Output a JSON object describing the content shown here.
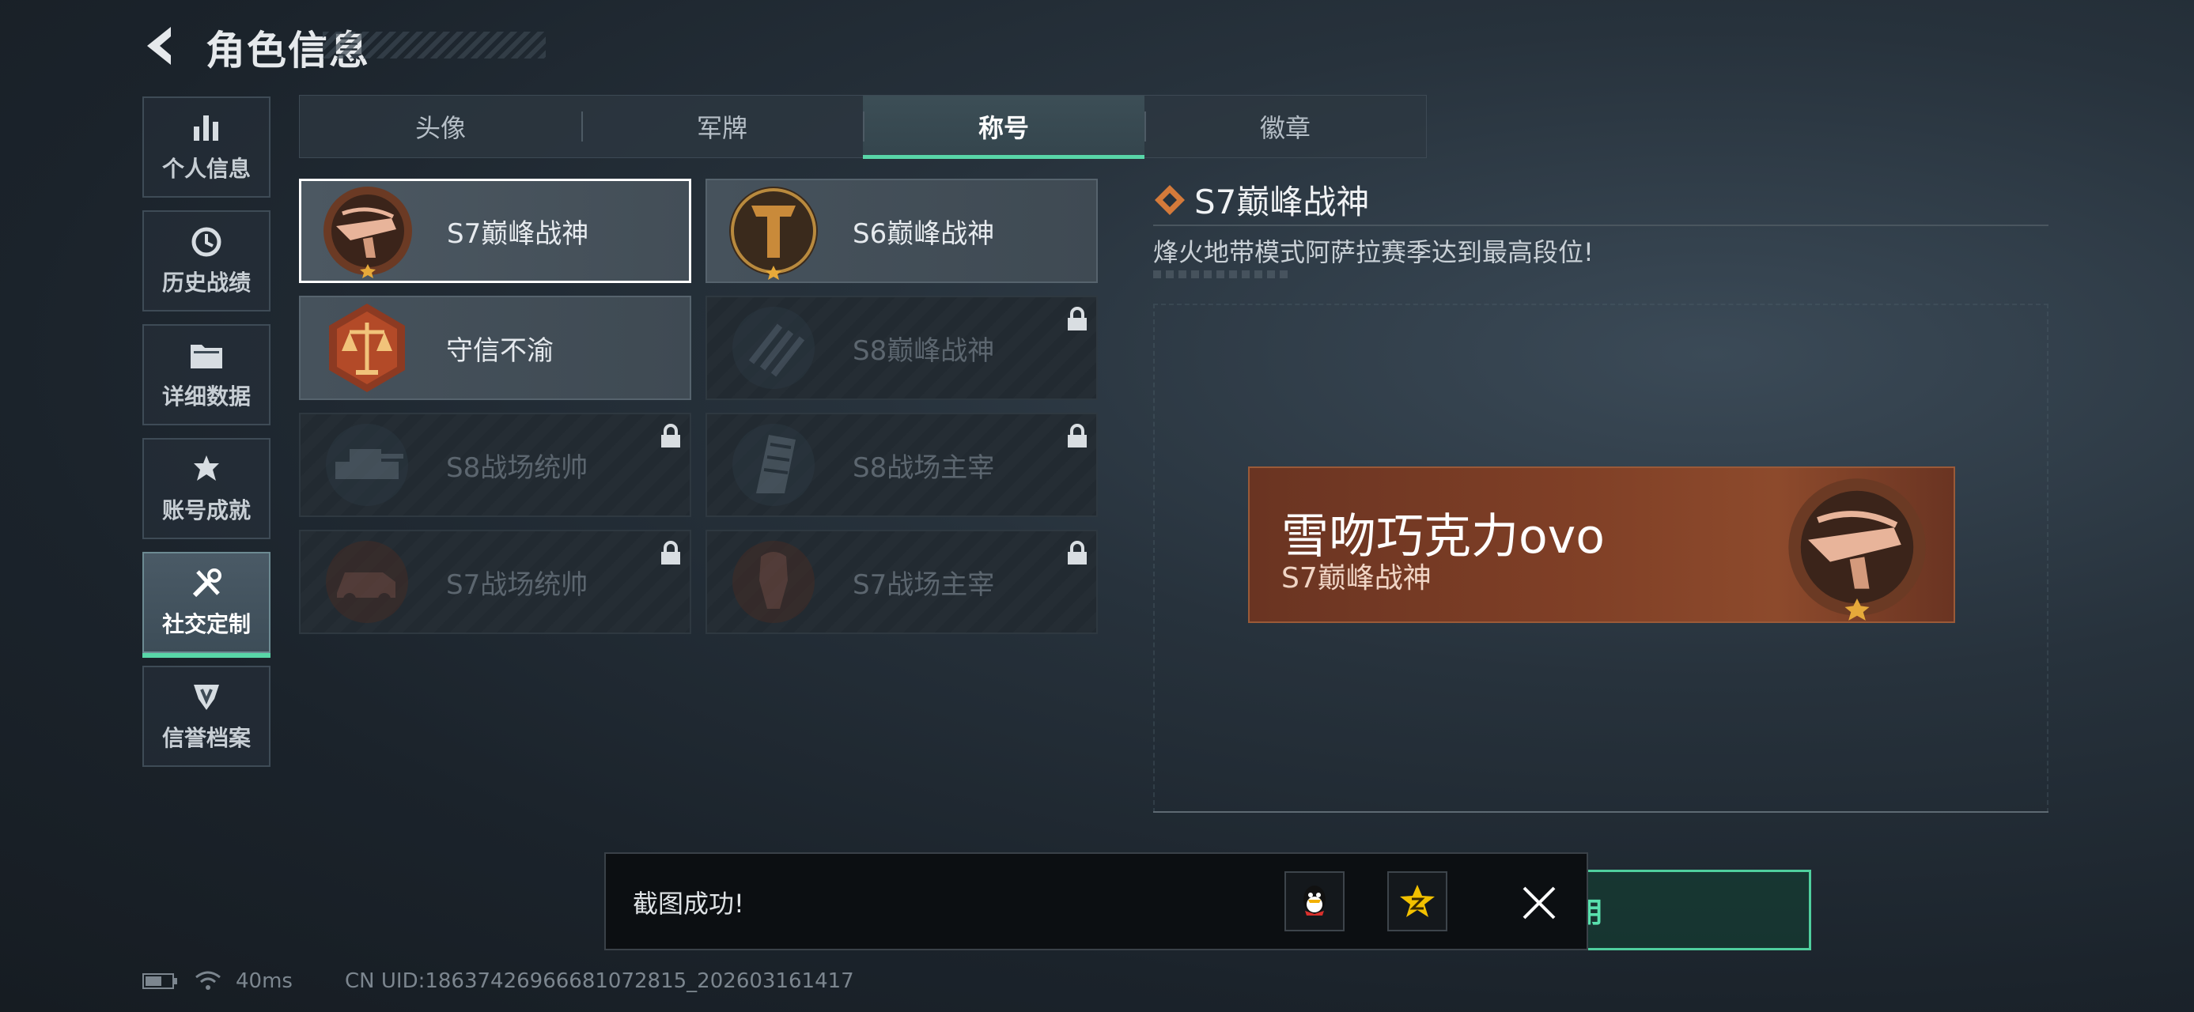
{
  "header": {
    "title": "角色信息"
  },
  "nav": {
    "items": [
      {
        "label": "个人信息",
        "icon": "bar-chart-icon"
      },
      {
        "label": "历史战绩",
        "icon": "clock-history-icon"
      },
      {
        "label": "详细数据",
        "icon": "folder-icon"
      },
      {
        "label": "账号成就",
        "icon": "achievement-icon"
      },
      {
        "label": "社交定制",
        "icon": "tools-icon",
        "active": true
      },
      {
        "label": "信誉档案",
        "icon": "shield-icon"
      }
    ]
  },
  "tabs": [
    {
      "label": "头像"
    },
    {
      "label": "军牌"
    },
    {
      "label": "称号",
      "active": true
    },
    {
      "label": "徽章"
    }
  ],
  "titles": [
    {
      "name": "S7巅峰战神",
      "locked": false,
      "selected": true,
      "emblem": "crossbow-emblem-icon"
    },
    {
      "name": "S6巅峰战神",
      "locked": false,
      "emblem": "t-shield-emblem-icon"
    },
    {
      "name": "守信不渝",
      "locked": false,
      "emblem": "scales-emblem-icon"
    },
    {
      "name": "S8巅峰战神",
      "locked": true,
      "emblem": "stripes-emblem-icon"
    },
    {
      "name": "S8战场统帅",
      "locked": true,
      "emblem": "tank-emblem-icon"
    },
    {
      "name": "S8战场主宰",
      "locked": true,
      "emblem": "tower-emblem-icon"
    },
    {
      "name": "S7战场统帅",
      "locked": true,
      "emblem": "vehicle-emblem-icon"
    },
    {
      "name": "S7战场主宰",
      "locked": true,
      "emblem": "soldier-emblem-icon"
    }
  ],
  "detail": {
    "title": "S7巅峰战神",
    "description": "烽火地带模式阿萨拉赛季达到最高段位!"
  },
  "preview": {
    "player_name": "雪吻巧克力ovo",
    "title": "S7巅峰战神"
  },
  "use_button": {
    "label": "使用"
  },
  "toast": {
    "message": "截图成功!"
  },
  "status": {
    "ping": "40ms",
    "uid": "CN UID:1863742696668107281​5_202603161417"
  },
  "colors": {
    "accent": "#58d6a8",
    "banner": "#7f3f26",
    "emblem_bronze": "#c9773f"
  }
}
